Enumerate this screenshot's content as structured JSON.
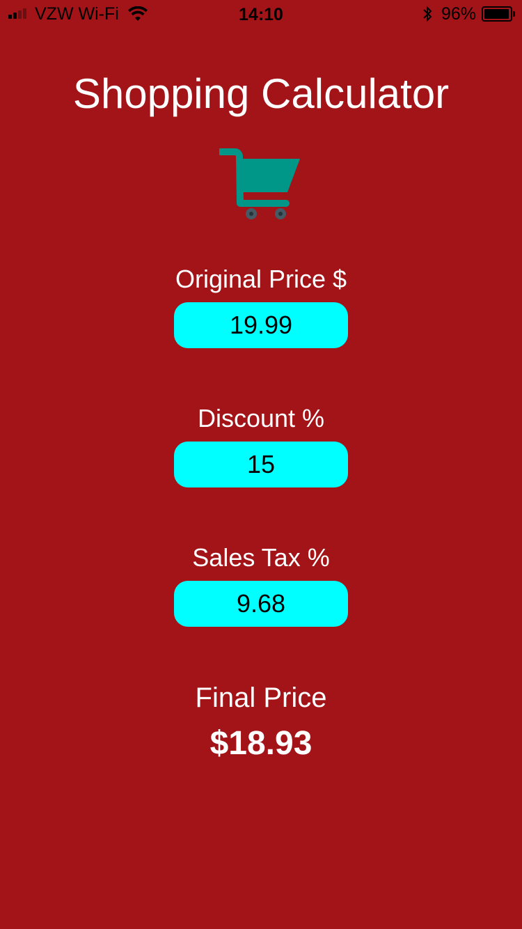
{
  "status_bar": {
    "carrier": "VZW Wi-Fi",
    "time": "14:10",
    "battery_percent": "96%",
    "battery_level": 0.96,
    "signal_bars_filled": 2,
    "signal_bars_total": 4
  },
  "title": "Shopping Calculator",
  "icon": "shopping-cart-icon",
  "colors": {
    "background": "#a31418",
    "input_background": "#00ffff",
    "cart": "#009688"
  },
  "fields": {
    "original_price": {
      "label": "Original Price $",
      "value": "19.99"
    },
    "discount": {
      "label": "Discount %",
      "value": "15"
    },
    "sales_tax": {
      "label": "Sales Tax %",
      "value": "9.68"
    }
  },
  "result": {
    "label": "Final Price",
    "value": "$18.93"
  }
}
